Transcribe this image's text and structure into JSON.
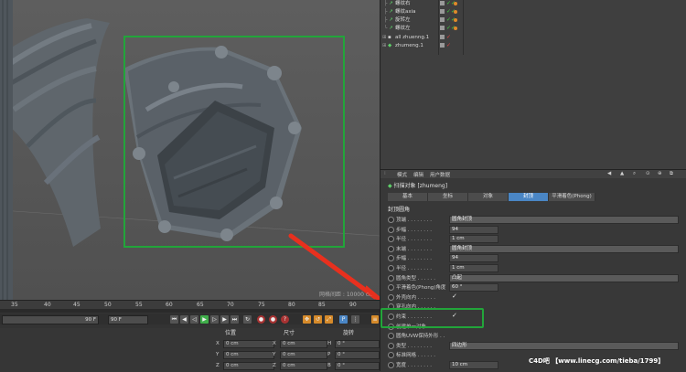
{
  "object_manager": {
    "rows": [
      {
        "name": "螺纹右",
        "tags": "✓✓"
      },
      {
        "name": "螺纹axia",
        "tags": "✓✓"
      },
      {
        "name": "旋转左",
        "tags": "✓✓"
      },
      {
        "name": "螺纹左",
        "tags": "✓✓"
      },
      {
        "name": "all zhuenng.1",
        "tags": "✓"
      },
      {
        "name": "zhumeng.1",
        "tags": "✓"
      }
    ]
  },
  "viewport": {
    "grid_spacing": "网格间距 : 10000 cm"
  },
  "attribute_manager": {
    "menu": [
      "模式",
      "编辑",
      "用户数据"
    ],
    "object_title": "扫描对象 [zhumeng]",
    "tabs": [
      "基本",
      "坐标",
      "对象",
      "封顶",
      "平滑着色(Phong)"
    ],
    "active_tab": "封顶",
    "section": "封顶圆角",
    "params": [
      {
        "label": "顶端 . . . . . . . .",
        "value": "圆角封顶",
        "kind": "dropdown"
      },
      {
        "label": "步幅 . . . . . . . .",
        "value": "94",
        "kind": "field"
      },
      {
        "label": "半径 . . . . . . . .",
        "value": "1 cm",
        "kind": "field"
      },
      {
        "label": "末端 . . . . . . . .",
        "value": "圆角封顶",
        "kind": "dropdown"
      },
      {
        "label": "步幅 . . . . . . . .",
        "value": "94",
        "kind": "field"
      },
      {
        "label": "半径 . . . . . . . .",
        "value": "1 cm",
        "kind": "field"
      },
      {
        "label": "圆角类型 . . . . . .",
        "value": "凸起",
        "kind": "dropdown"
      },
      {
        "label": "平滑着色(Phong)角度",
        "value": "60 °",
        "kind": "field"
      },
      {
        "label": "外壳向内 . . . . . .",
        "value": "✓",
        "kind": "check"
      },
      {
        "label": "穿孔向内 . . . . . .",
        "value": "",
        "kind": "check"
      },
      {
        "label": "约束 . . . . . . . .",
        "value": "✓",
        "kind": "check"
      },
      {
        "label": "创建单一对象 . . . .",
        "value": "",
        "kind": "check"
      },
      {
        "label": "圆角UVW保持外形 . .",
        "value": "",
        "kind": "check"
      },
      {
        "label": "类型 . . . . . . . .",
        "value": "四边形",
        "kind": "dropdown"
      },
      {
        "label": "标准网格 . . . . . .",
        "value": "",
        "kind": "check"
      },
      {
        "label": "宽度 . . . . . . . .",
        "value": "10 cm",
        "kind": "field"
      }
    ]
  },
  "timeline": {
    "ticks": [
      "35",
      "40",
      "45",
      "50",
      "55",
      "60",
      "65",
      "70",
      "75",
      "80",
      "85",
      "90"
    ],
    "end_frame_a": "90 F",
    "end_frame_b": "90 F",
    "headers": [
      "位置",
      "尺寸",
      "旋转"
    ],
    "coords": [
      {
        "axis": "X",
        "pos": "0 cm",
        "size": "0 cm",
        "rot_axis": "H",
        "rot": "0 °"
      },
      {
        "axis": "Y",
        "pos": "0 cm",
        "size": "0 cm",
        "rot_axis": "P",
        "rot": "0 °"
      },
      {
        "axis": "Z",
        "pos": "0 cm",
        "size": "0 cm",
        "rot_axis": "B",
        "rot": "0 °"
      }
    ]
  },
  "watermark": "C4D吧 【www.linecg.com/tieba/1799】",
  "colors": {
    "highlight_green": "#22a53a",
    "arrow_red": "#e8301e",
    "tab_active": "#4a86c5",
    "check_green": "#3fce3f"
  }
}
